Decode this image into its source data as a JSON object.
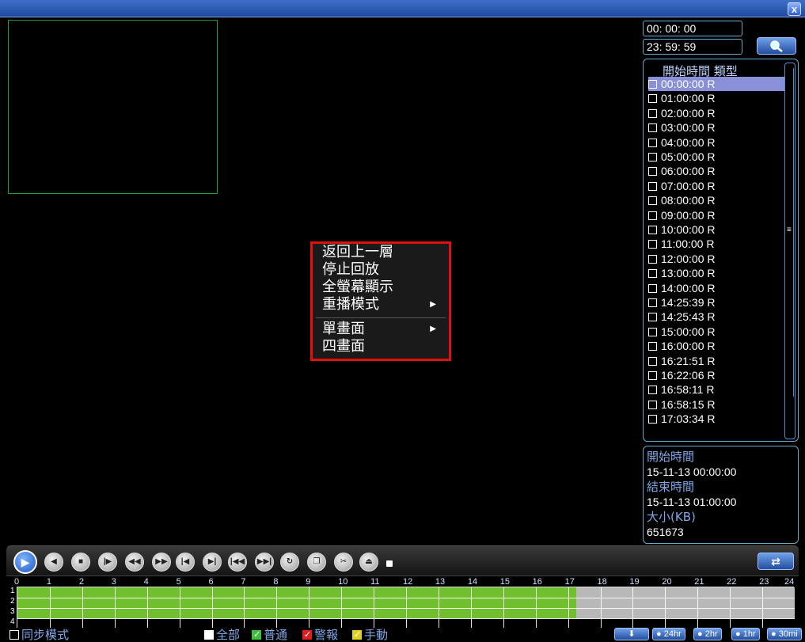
{
  "window": {
    "close_label": "x"
  },
  "time_search": {
    "start_time": "00: 00: 00",
    "end_time": "23: 59: 59"
  },
  "context_menu": {
    "items": [
      {
        "label": "返回上一層",
        "has_submenu": false
      },
      {
        "label": "停止回放",
        "has_submenu": false
      },
      {
        "label": "全螢幕顯示",
        "has_submenu": false
      },
      {
        "label": "重播模式",
        "has_submenu": true
      },
      {
        "label": "單畫面",
        "has_submenu": true
      },
      {
        "label": "四畫面",
        "has_submenu": false
      }
    ],
    "border_color": "#e01010"
  },
  "file_list": {
    "header": "開始時間 類型",
    "rows": [
      {
        "time": "00:00:00",
        "type": "R"
      },
      {
        "time": "01:00:00",
        "type": "R"
      },
      {
        "time": "02:00:00",
        "type": "R"
      },
      {
        "time": "03:00:00",
        "type": "R"
      },
      {
        "time": "04:00:00",
        "type": "R"
      },
      {
        "time": "05:00:00",
        "type": "R"
      },
      {
        "time": "06:00:00",
        "type": "R"
      },
      {
        "time": "07:00:00",
        "type": "R"
      },
      {
        "time": "08:00:00",
        "type": "R"
      },
      {
        "time": "09:00:00",
        "type": "R"
      },
      {
        "time": "10:00:00",
        "type": "R"
      },
      {
        "time": "11:00:00",
        "type": "R"
      },
      {
        "time": "12:00:00",
        "type": "R"
      },
      {
        "time": "13:00:00",
        "type": "R"
      },
      {
        "time": "14:00:00",
        "type": "R"
      },
      {
        "time": "14:25:39",
        "type": "R"
      },
      {
        "time": "14:25:43",
        "type": "R"
      },
      {
        "time": "15:00:00",
        "type": "R"
      },
      {
        "time": "16:00:00",
        "type": "R"
      },
      {
        "time": "16:21:51",
        "type": "R"
      },
      {
        "time": "16:22:06",
        "type": "R"
      },
      {
        "time": "16:58:11",
        "type": "R"
      },
      {
        "time": "16:58:15",
        "type": "R"
      },
      {
        "time": "17:03:34",
        "type": "R"
      }
    ],
    "selected_index": 0,
    "selected_color": "#8a90d8"
  },
  "file_info": {
    "start_label": "開始時間",
    "start_value": "15-11-13 00:00:00",
    "end_label": "結束時間",
    "end_value": "15-11-13 01:00:00",
    "size_label": "大小(KB)",
    "size_value": "651673"
  },
  "controls": {
    "buttons": [
      "play",
      "slow-reverse",
      "stop",
      "step-forward",
      "rewind",
      "fast-forward",
      "prev-frame",
      "next-frame",
      "prev-file",
      "next-file",
      "loop",
      "copy-window",
      "clip",
      "backup"
    ]
  },
  "timeline": {
    "hours": [
      "0",
      "1",
      "2",
      "3",
      "4",
      "5",
      "6",
      "7",
      "8",
      "9",
      "10",
      "11",
      "12",
      "13",
      "14",
      "15",
      "16",
      "17",
      "18",
      "19",
      "20",
      "21",
      "22",
      "23",
      "24"
    ],
    "channels": [
      "1",
      "2",
      "3",
      "4"
    ],
    "recorded_until_hour": 17.25,
    "recorded_color": "#6fbf2f",
    "empty_color": "#b8b8b8"
  },
  "bottom_bar": {
    "sync_label": "同步模式",
    "filters": [
      {
        "label": "全部",
        "checked": true,
        "color": "#ffffff"
      },
      {
        "label": "普通",
        "checked": true,
        "color": "#3fbf3f"
      },
      {
        "label": "警報",
        "checked": true,
        "color": "#e02020"
      },
      {
        "label": "手動",
        "checked": true,
        "color": "#e0d020"
      }
    ],
    "zoom_options": [
      "24hr",
      "2hr",
      "1hr",
      "30mi"
    ]
  }
}
